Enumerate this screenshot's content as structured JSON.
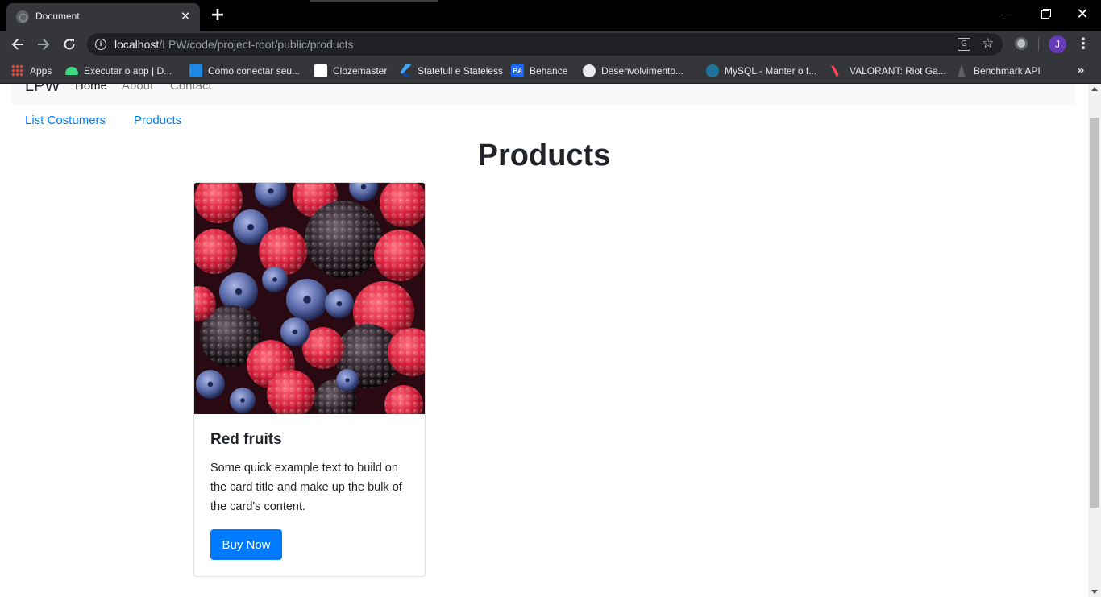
{
  "browser": {
    "tab_title": "Document",
    "tab_close": "✕",
    "new_tab": "+",
    "url_host": "localhost",
    "url_path": "/LPW/code/project-root/public/products",
    "avatar_letter": "J",
    "window_controls": {
      "close": "✕"
    }
  },
  "bookmarks": [
    {
      "label": "Apps",
      "icon": "apps-grid-icon"
    },
    {
      "label": "Executar o app | D...",
      "icon": "android-icon"
    },
    {
      "label": "Como conectar seu...",
      "icon": "m-logo-icon"
    },
    {
      "label": "Clozemaster",
      "icon": "clozemaster-icon"
    },
    {
      "label": "Statefull e Stateless",
      "icon": "flutter-icon"
    },
    {
      "label": "Behance",
      "icon": "behance-icon"
    },
    {
      "label": "Desenvolvimento...",
      "icon": "globe-icon"
    },
    {
      "label": "MySQL - Manter o f...",
      "icon": "wordpress-icon"
    },
    {
      "label": "VALORANT: Riot Ga...",
      "icon": "valorant-icon"
    },
    {
      "label": "Benchmark API",
      "icon": "benchmark-icon"
    }
  ],
  "site_nav": {
    "brand": "LPW",
    "links": [
      "Home",
      "About",
      "Contact"
    ]
  },
  "sub_links": [
    "List Costumers",
    "Products"
  ],
  "page": {
    "heading": "Products"
  },
  "product": {
    "image_alt": "Red fruits",
    "title": "Red fruits",
    "text": "Some quick example text to build on the card title and make up the bulk of the card's content.",
    "button": "Buy Now"
  },
  "colors": {
    "link": "#007bff",
    "button": "#007bff",
    "chrome_dark": "#35363a",
    "navbar_bg": "#f8f9fa"
  }
}
